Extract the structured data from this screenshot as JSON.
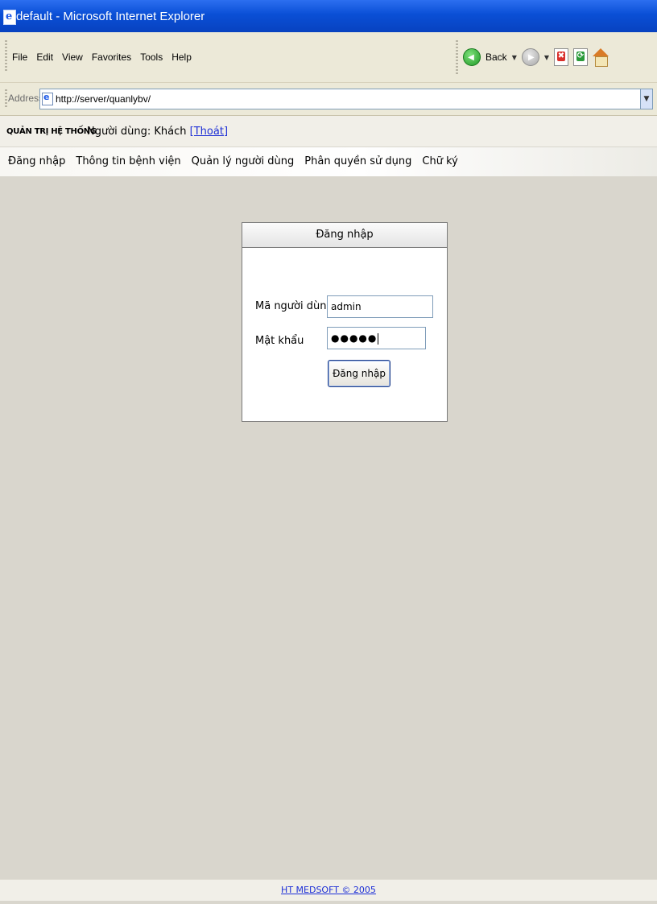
{
  "window": {
    "title": "default - Microsoft Internet Explorer"
  },
  "menubar": {
    "items": [
      "File",
      "Edit",
      "View",
      "Favorites",
      "Tools",
      "Help"
    ]
  },
  "toolbar": {
    "back_label": "Back"
  },
  "address": {
    "label": "Address",
    "url": "http://server/quanlybv/"
  },
  "header": {
    "app_title": "QUẢN TRỊ HỆ THỐNG",
    "user_prefix": "Người dùng: Khách",
    "logout": "[Thoát]"
  },
  "nav": {
    "items": [
      "Đăng nhập",
      "Thông tin bệnh viện",
      "Quản lý người dùng",
      "Phân quyền sử dụng",
      "Chữ ký"
    ]
  },
  "login": {
    "title": "Đăng nhập",
    "username_label": "Mã người dùng",
    "username_value": "admin",
    "password_label": "Mật khẩu",
    "password_value": "●●●●●",
    "submit_label": "Đăng nhập"
  },
  "footer": {
    "text": "HT MEDSOFT © 2005"
  }
}
